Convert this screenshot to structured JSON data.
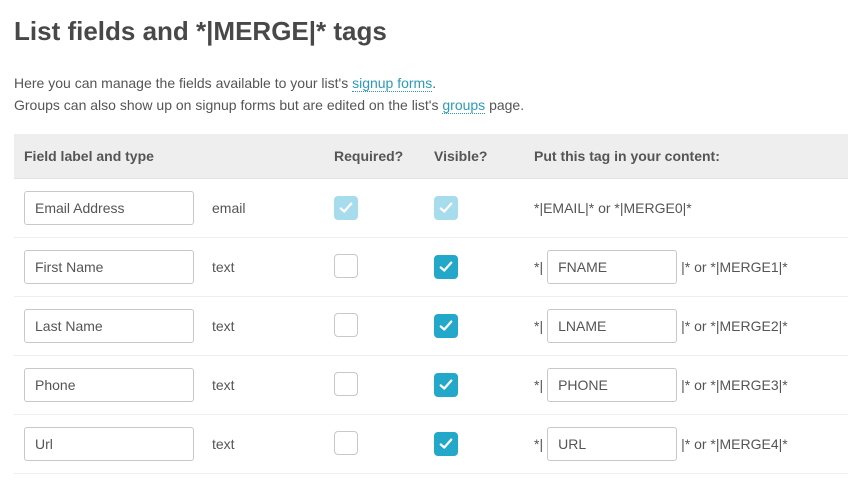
{
  "page_title": "List fields and *|MERGE|* tags",
  "intro": {
    "line1_a": "Here you can manage the fields available to your list's ",
    "line1_link": "signup forms",
    "line1_b": ".",
    "line2_a": "Groups can also show up on signup forms but are edited on the list's ",
    "line2_link": "groups",
    "line2_b": " page."
  },
  "headers": {
    "label": "Field label and type",
    "required": "Required?",
    "visible": "Visible?",
    "tag": "Put this tag in your content:"
  },
  "glossary": {
    "delim_open": "*|",
    "delim_close": "|*",
    "or": " or "
  },
  "rows": [
    {
      "label": "Email Address",
      "type": "email",
      "required": true,
      "required_locked": true,
      "visible": true,
      "visible_locked": true,
      "tag_editable": false,
      "tag_text": "*|EMAIL|* or *|MERGE0|*"
    },
    {
      "label": "First Name",
      "type": "text",
      "required": false,
      "required_locked": false,
      "visible": true,
      "visible_locked": false,
      "tag_editable": true,
      "tag_value": "FNAME",
      "merge_suffix": "*|MERGE1|*"
    },
    {
      "label": "Last Name",
      "type": "text",
      "required": false,
      "required_locked": false,
      "visible": true,
      "visible_locked": false,
      "tag_editable": true,
      "tag_value": "LNAME",
      "merge_suffix": "*|MERGE2|*"
    },
    {
      "label": "Phone",
      "type": "text",
      "required": false,
      "required_locked": false,
      "visible": true,
      "visible_locked": false,
      "tag_editable": true,
      "tag_value": "PHONE",
      "merge_suffix": "*|MERGE3|*"
    },
    {
      "label": "Url",
      "type": "text",
      "required": false,
      "required_locked": false,
      "visible": true,
      "visible_locked": false,
      "tag_editable": true,
      "tag_value": "URL",
      "merge_suffix": "*|MERGE4|*"
    }
  ]
}
